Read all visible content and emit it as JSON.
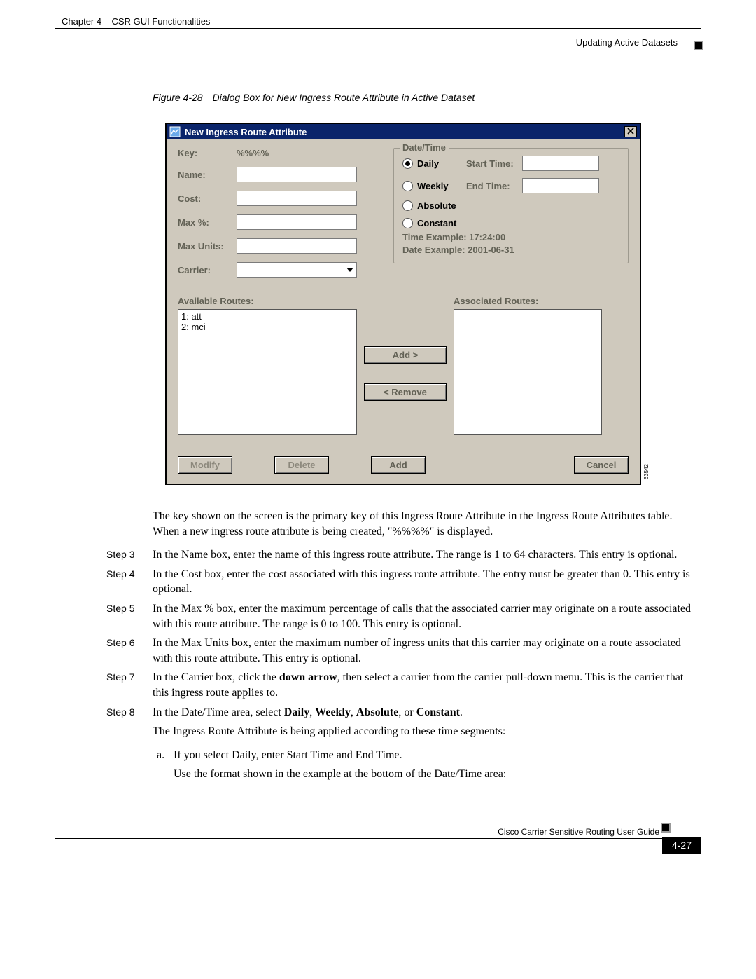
{
  "header": {
    "chapter": "Chapter 4",
    "chapter_title": "CSR GUI Functionalities",
    "section": "Updating Active Datasets"
  },
  "figure": {
    "number": "Figure 4-28",
    "caption": "Dialog Box for New Ingress Route Attribute in Active Dataset",
    "img_num": "63542"
  },
  "dialog": {
    "title": "New Ingress Route Attribute",
    "close": "X",
    "labels": {
      "key": "Key:",
      "name": "Name:",
      "cost": "Cost:",
      "maxpct": "Max %:",
      "maxunits": "Max Units:",
      "carrier": "Carrier:"
    },
    "key_value": "%%%%",
    "datetime": {
      "group": "Date/Time",
      "daily": "Daily",
      "weekly": "Weekly",
      "absolute": "Absolute",
      "constant": "Constant",
      "start": "Start Time:",
      "end": "End Time:",
      "time_example": "Time Example: 17:24:00",
      "date_example": "Date Example: 2001-06-31"
    },
    "routes": {
      "avail_label": "Available Routes:",
      "assoc_label": "Associated Routes:",
      "items": [
        "1: att",
        "2: mci"
      ],
      "add": "Add >",
      "remove": "< Remove"
    },
    "buttons": {
      "modify": "Modify",
      "delete": "Delete",
      "add": "Add",
      "cancel": "Cancel"
    }
  },
  "body": {
    "intro": "The key shown on the screen is the primary key of this Ingress Route Attribute in the Ingress Route Attributes table. When a new ingress route attribute is being created, \"%%%%\" is displayed.",
    "step3_label": "Step 3",
    "step3": "In the Name box, enter the name of this ingress route attribute. The range is 1 to 64 characters. This entry is optional.",
    "step4_label": "Step 4",
    "step4": "In the Cost box, enter the cost associated with this ingress route attribute. The entry must be greater than 0. This entry is optional.",
    "step5_label": "Step 5",
    "step5": "In the Max % box, enter the maximum percentage of calls that the associated carrier may originate on a route associated with this route attribute. The range is 0 to 100. This entry is optional.",
    "step6_label": "Step 6",
    "step6": "In the Max Units box, enter the maximum number of ingress units that this carrier may originate on a route associated with this route attribute. This entry is optional.",
    "step7_label": "Step 7",
    "step7_pre": "In the Carrier box, click the ",
    "step7_bold": "down arrow",
    "step7_post": ", then select a carrier from the carrier pull-down menu. This is the carrier that this ingress route applies to.",
    "step8_label": "Step 8",
    "step8_pre": "In the Date/Time area, select ",
    "step8_b1": "Daily",
    "step8_b2": "Weekly",
    "step8_b3": "Absolute",
    "step8_b4": "Constant",
    "step8_after": "The Ingress Route Attribute is being applied according to these time segments:",
    "sub_a_label": "a.",
    "sub_a": "If you select Daily, enter Start Time and End Time.",
    "sub_a2": "Use the format shown in the example at the bottom of the Date/Time area:"
  },
  "footer": {
    "guide": "Cisco Carrier Sensitive Routing User Guide",
    "page": "4-27"
  }
}
